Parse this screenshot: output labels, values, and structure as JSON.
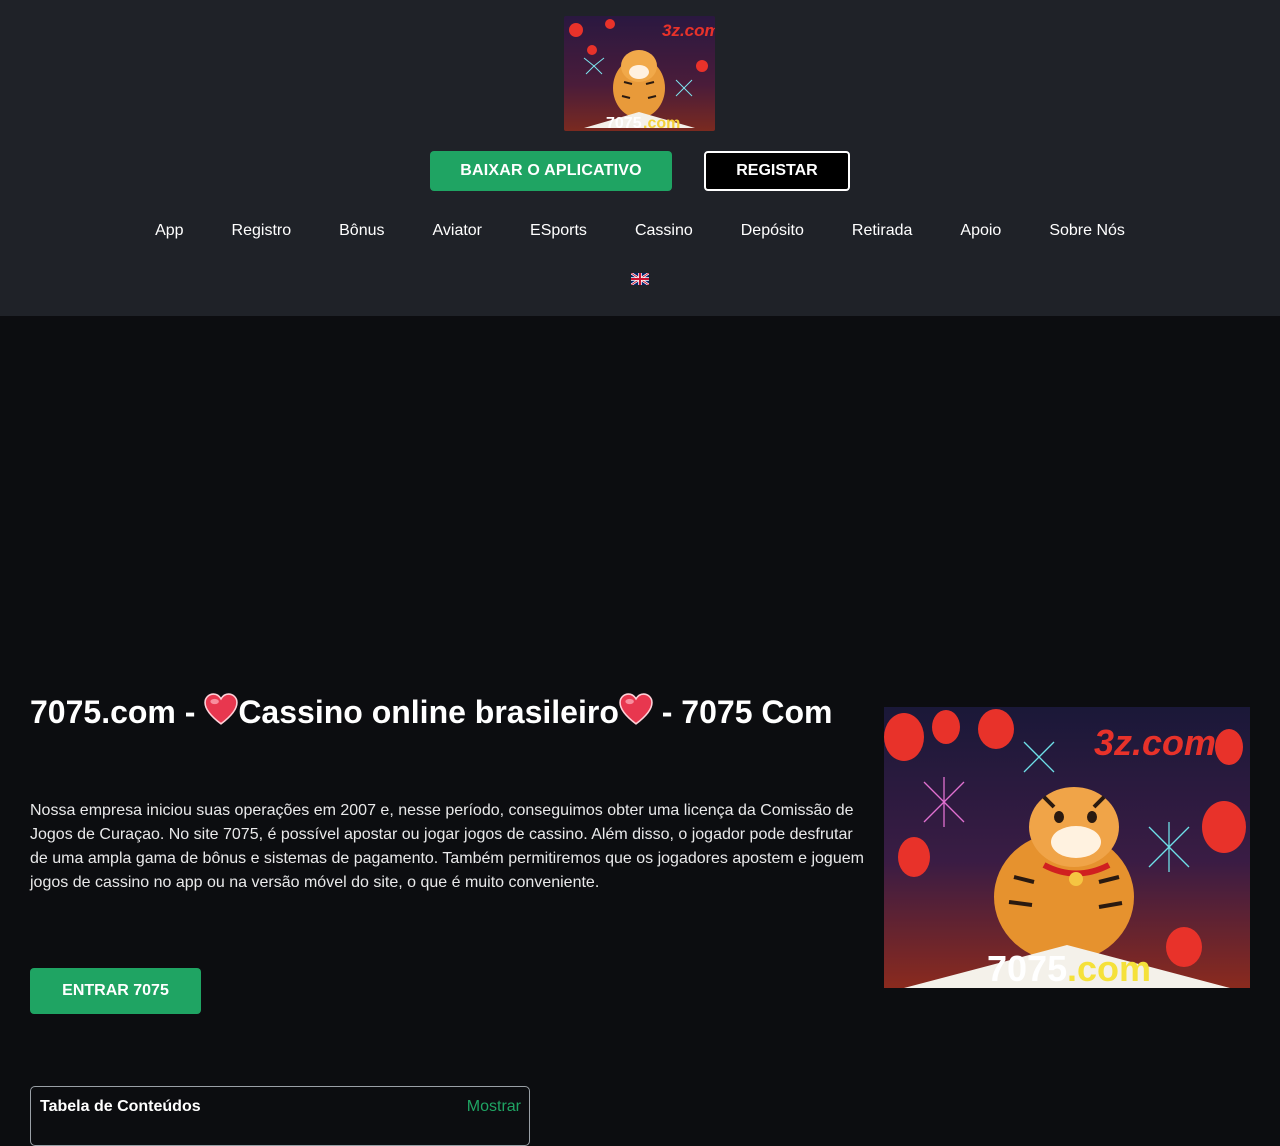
{
  "header": {
    "logo_text_top": "3z.com",
    "logo_text_bottom_a": "7075",
    "logo_text_bottom_b": ".com",
    "download_label": "BAIXAR O APLICATIVO",
    "register_label": "REGISTAR",
    "nav": [
      "App",
      "Registro",
      "Bônus",
      "Aviator",
      "ESports",
      "Cassino",
      "Depósito",
      "Retirada",
      "Apoio",
      "Sobre Nós"
    ],
    "language_flag": "uk-flag-icon"
  },
  "main": {
    "title_part1": "7075.com - ",
    "title_part2": "Cassino online brasileiro",
    "title_part3": " - 7075 Com",
    "paragraph": "Nossa empresa iniciou suas operações em 2007 e, nesse período, conseguimos obter uma licença da Comissão de Jogos de Curaçao. No site 7075, é possível apostar ou jogar jogos de cassino. Além disso, o jogador pode desfrutar de uma ampla gama de bônus e sistemas de pagamento. Também permitiremos que os jogadores apostem e joguem jogos de cassino no app ou na versão móvel do site, o que é muito conveniente.",
    "enter_label": "ENTRAR 7075",
    "hero_text_top": "3z.com",
    "hero_text_bottom_a": "7075",
    "hero_text_bottom_b": ".com"
  },
  "toc": {
    "title": "Tabela de Conteúdos",
    "toggle": "Mostrar"
  },
  "colors": {
    "header_bg": "#1f2228",
    "page_bg": "#0c0d10",
    "accent_green": "#1fa463",
    "heart": "#e8374f"
  }
}
